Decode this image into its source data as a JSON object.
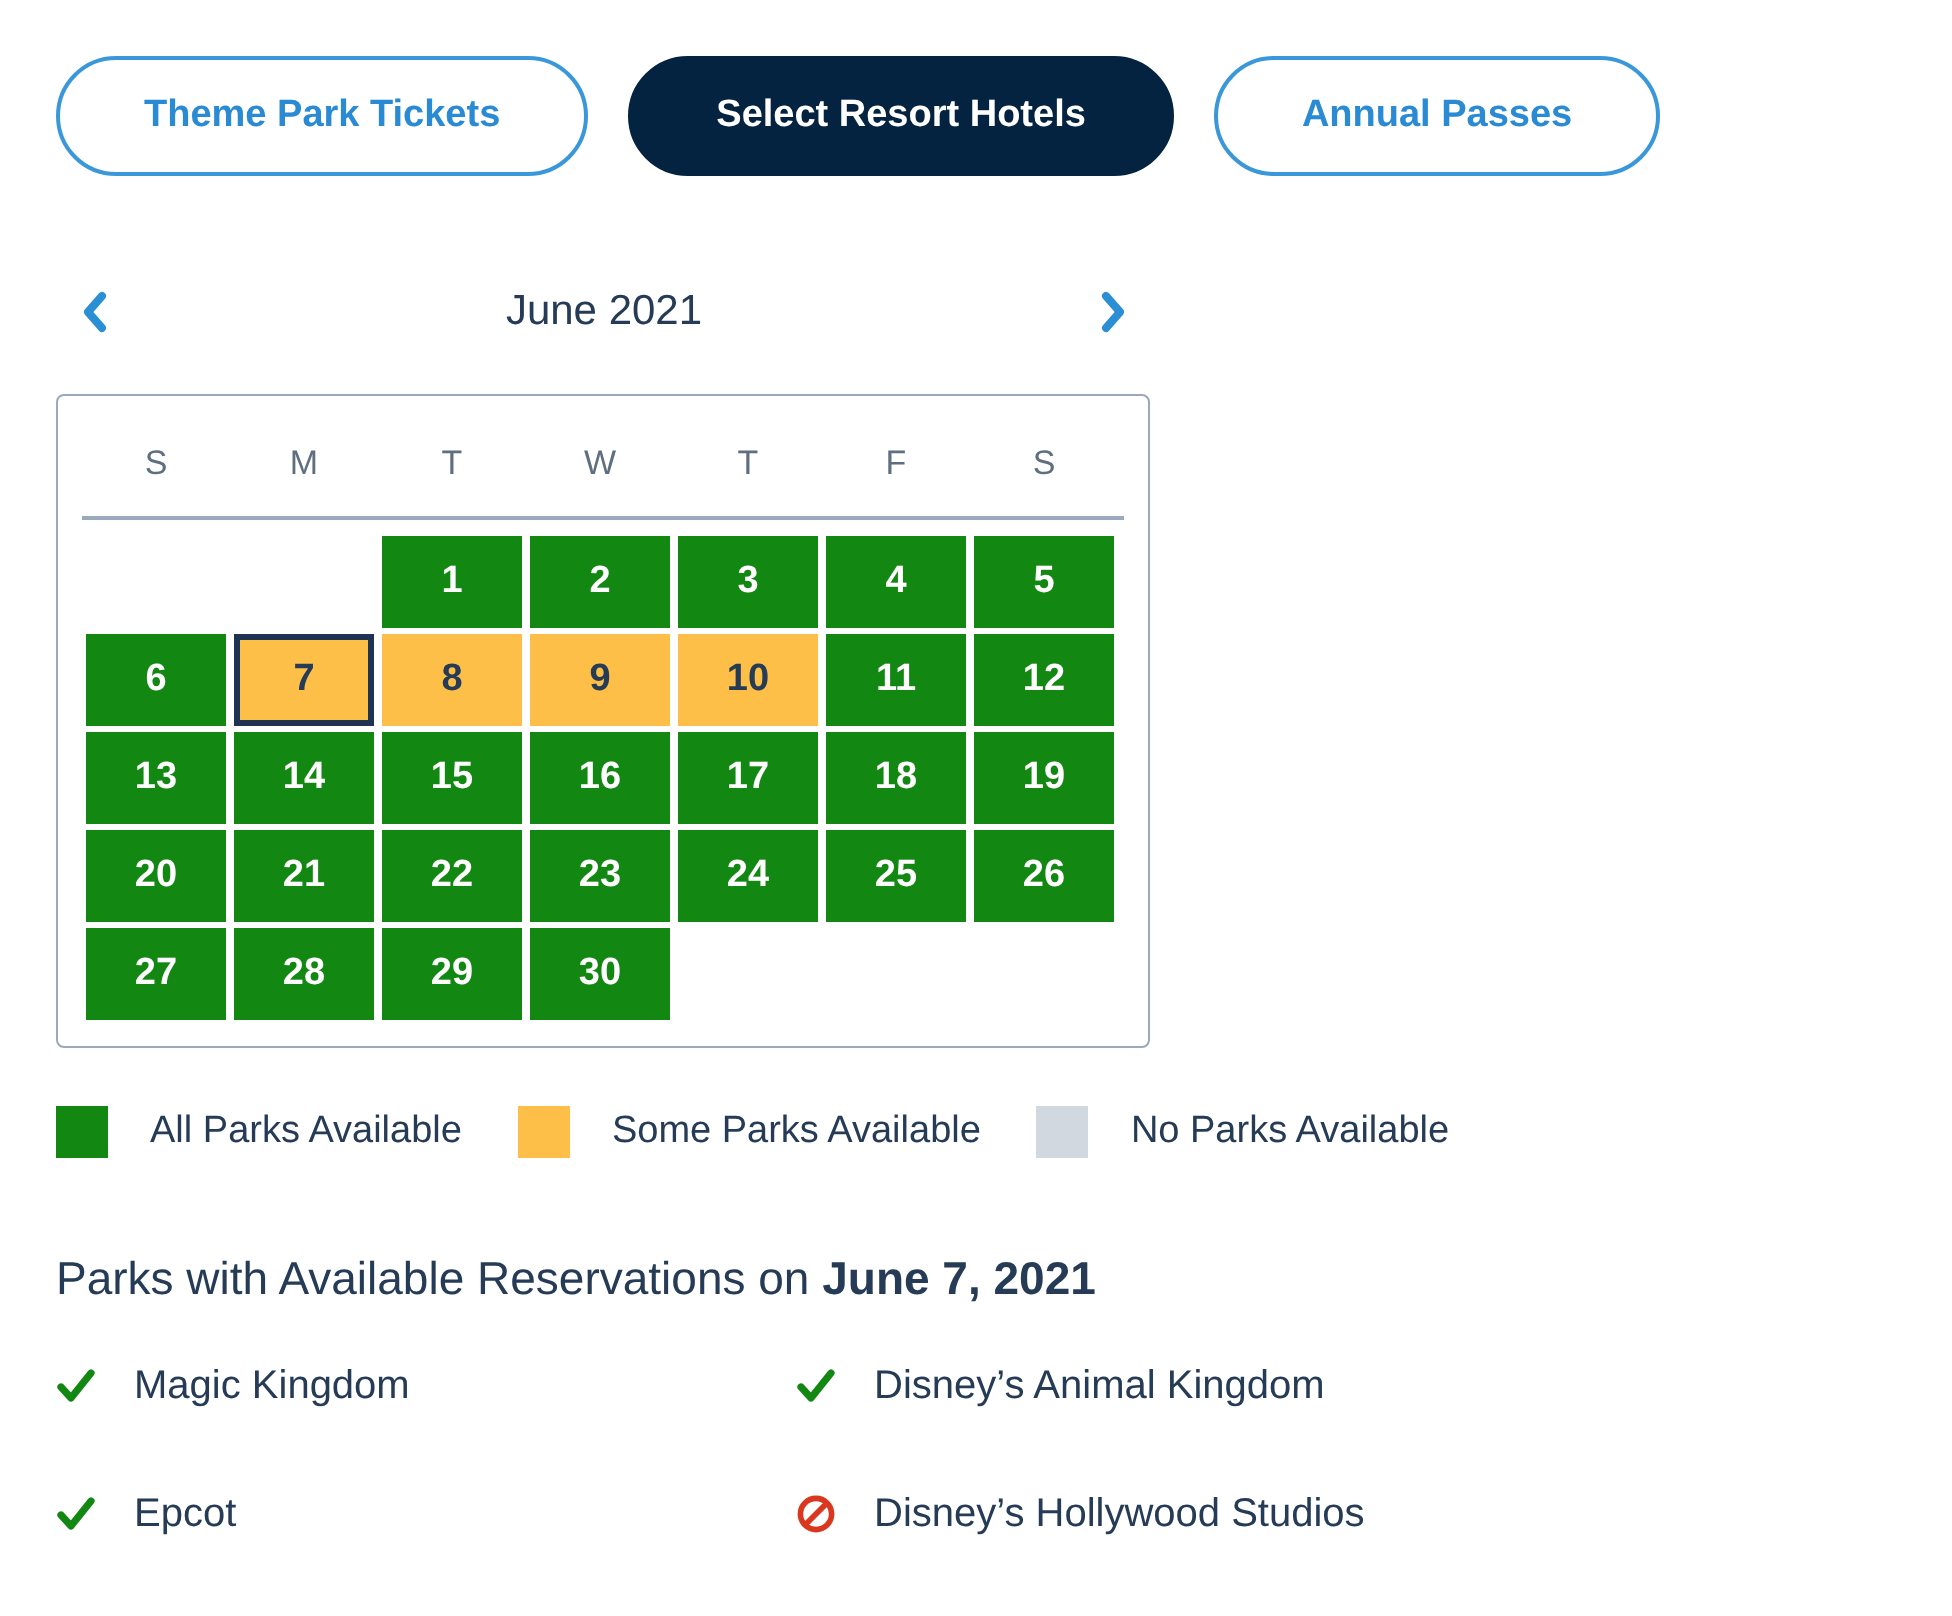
{
  "tabs": [
    {
      "label": "Theme Park Tickets",
      "selected": false
    },
    {
      "label": "Select Resort Hotels",
      "selected": true
    },
    {
      "label": "Annual Passes",
      "selected": false
    }
  ],
  "calendar": {
    "month": "June 2021",
    "weekdays": [
      "S",
      "M",
      "T",
      "W",
      "T",
      "F",
      "S"
    ],
    "weeks": [
      {
        "days": [
          {
            "label": "1",
            "color": "#128712",
            "selected": false
          },
          {
            "label": "2",
            "color": "#128712",
            "selected": false
          },
          {
            "label": "3",
            "color": "#128712",
            "selected": false
          },
          {
            "label": "4",
            "color": "#128712",
            "selected": false
          },
          {
            "label": "5",
            "color": "#128712",
            "selected": false
          }
        ]
      },
      {
        "days": [
          {
            "label": "6",
            "color": "#128712",
            "selected": false
          },
          {
            "label": "7",
            "color": "#fdbf48",
            "selected": true
          },
          {
            "label": "8",
            "color": "#fdbf48",
            "selected": false
          },
          {
            "label": "9",
            "color": "#fdbf48",
            "selected": false
          },
          {
            "label": "10",
            "color": "#fdbf48",
            "selected": false
          },
          {
            "label": "11",
            "color": "#128712",
            "selected": false
          },
          {
            "label": "12",
            "color": "#128712",
            "selected": false
          }
        ]
      },
      {
        "days": [
          {
            "label": "13",
            "color": "#128712",
            "selected": false
          },
          {
            "label": "14",
            "color": "#128712",
            "selected": false
          },
          {
            "label": "15",
            "color": "#128712",
            "selected": false
          },
          {
            "label": "16",
            "color": "#128712",
            "selected": false
          },
          {
            "label": "17",
            "color": "#128712",
            "selected": false
          },
          {
            "label": "18",
            "color": "#128712",
            "selected": false
          },
          {
            "label": "19",
            "color": "#128712",
            "selected": false
          }
        ]
      },
      {
        "days": [
          {
            "label": "20",
            "color": "#128712",
            "selected": false
          },
          {
            "label": "21",
            "color": "#128712",
            "selected": false
          },
          {
            "label": "22",
            "color": "#128712",
            "selected": false
          },
          {
            "label": "23",
            "color": "#128712",
            "selected": false
          },
          {
            "label": "24",
            "color": "#128712",
            "selected": false
          },
          {
            "label": "25",
            "color": "#128712",
            "selected": false
          },
          {
            "label": "26",
            "color": "#128712",
            "selected": false
          }
        ]
      },
      {
        "days": [
          {
            "label": "27",
            "color": "#128712",
            "selected": false
          },
          {
            "label": "28",
            "color": "#128712",
            "selected": false
          },
          {
            "label": "29",
            "color": "#128712",
            "selected": false
          },
          {
            "label": "30",
            "color": "#128712",
            "selected": false
          }
        ]
      }
    ]
  },
  "legend": [
    {
      "label": "All Parks Available",
      "color": "#128712"
    },
    {
      "label": "Some Parks Available",
      "color": "#fdbf48"
    },
    {
      "label": "No Parks Available",
      "color": "#d1d8df"
    }
  ],
  "reservations": {
    "heading": "Parks with Available Reservations on **June 7, 2021**",
    "parks": [
      {
        "name": "Magic Kingdom",
        "available": true
      },
      {
        "name": "Disney’s Animal Kingdom",
        "available": true
      },
      {
        "name": "Epcot",
        "available": true
      },
      {
        "name": "Disney’s Hollywood Studios",
        "available": false
      }
    ]
  }
}
